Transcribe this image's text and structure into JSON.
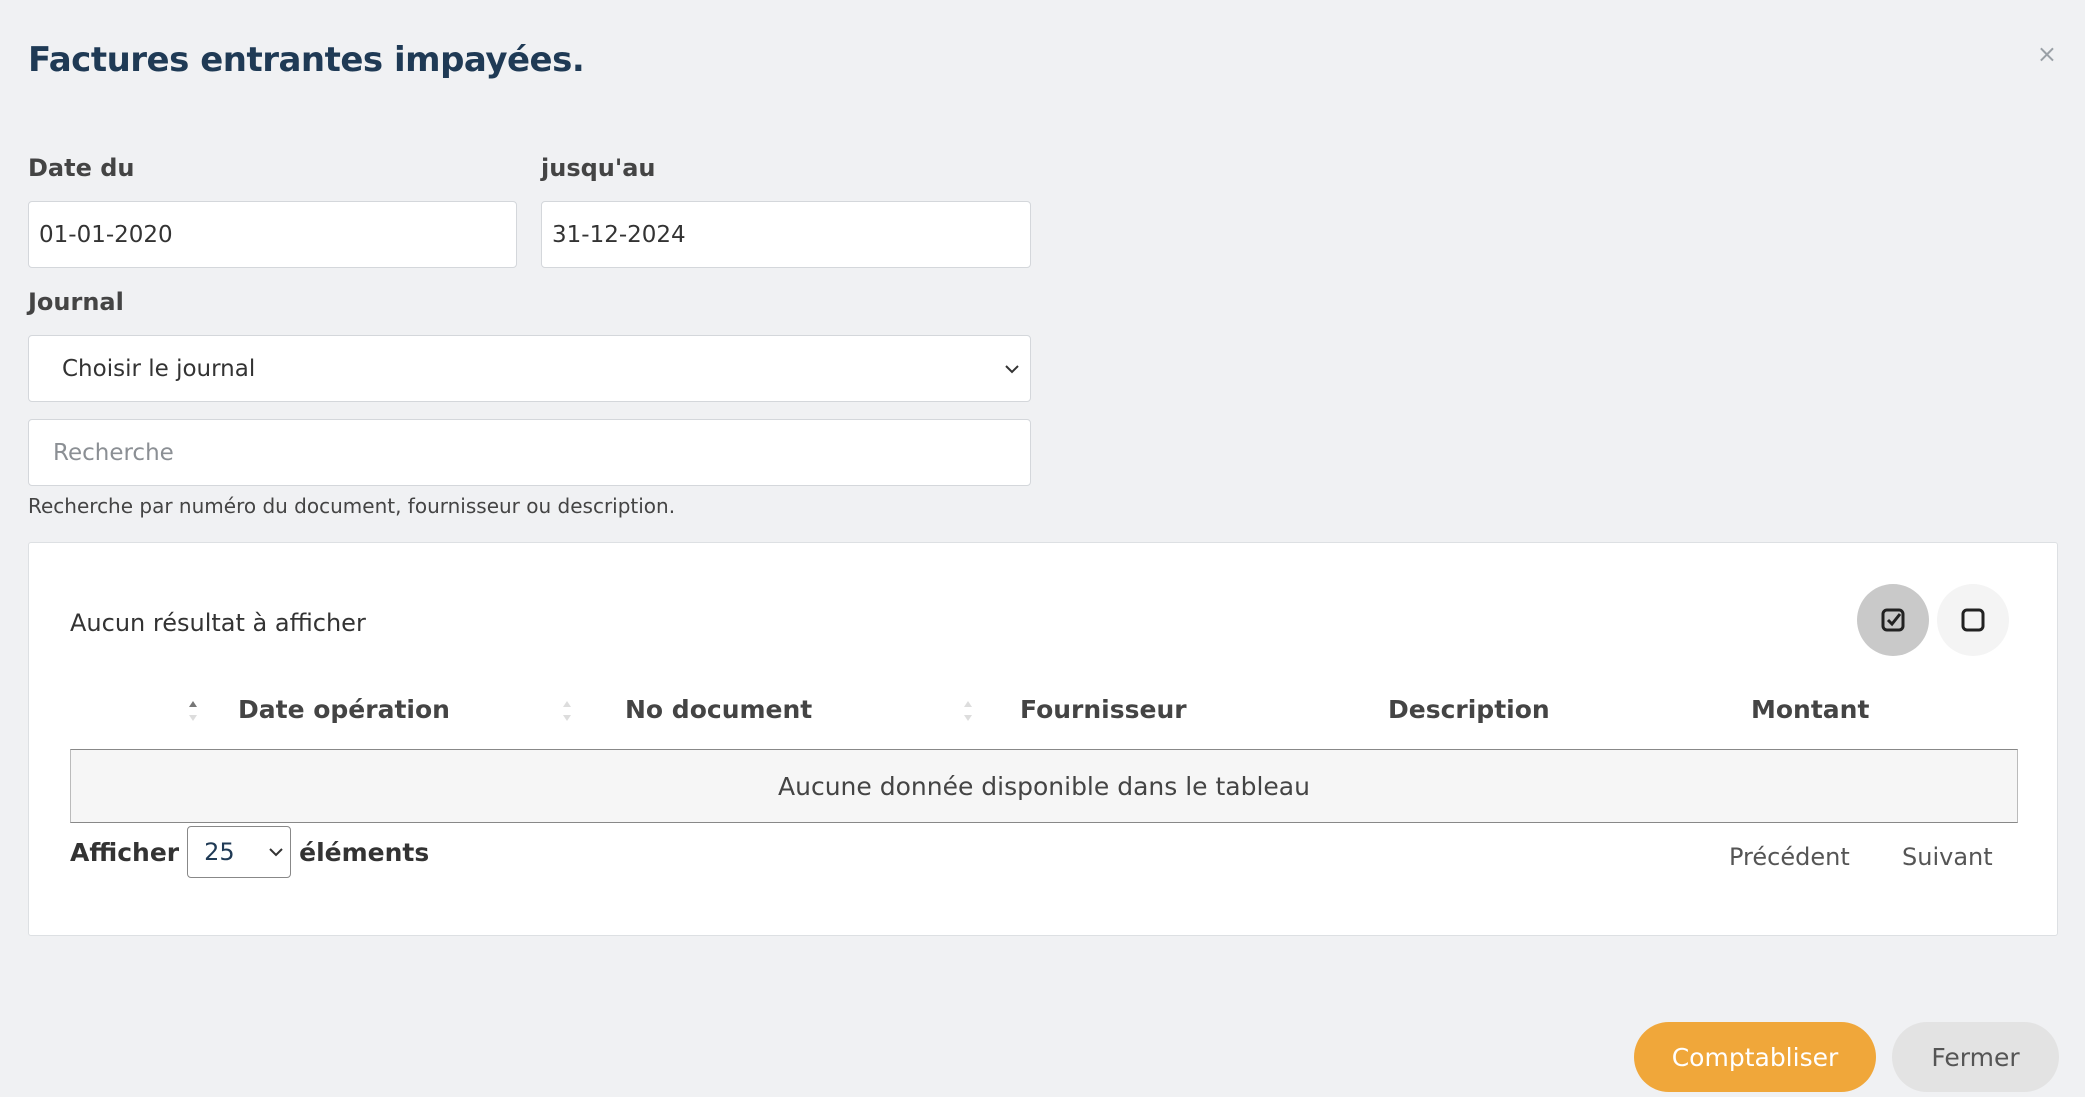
{
  "modal": {
    "title": "Factures entrantes impayées.",
    "close_glyph": "×"
  },
  "filters": {
    "date_from_label": "Date du",
    "date_from_value": "01-01-2020",
    "date_to_label": "jusqu'au",
    "date_to_value": "31-12-2024",
    "journal_label": "Journal",
    "journal_selected": "Choisir le journal",
    "search_placeholder": "Recherche",
    "search_help": "Recherche par numéro du document, fournisseur ou description."
  },
  "results": {
    "status_text": "Aucun résultat à afficher",
    "check_all_icon": "check-square-icon",
    "uncheck_all_icon": "square-icon",
    "columns": [
      "",
      "Date opération",
      "No document",
      "Fournisseur",
      "Description",
      "Montant"
    ],
    "empty_message": "Aucune donnée disponible dans le tableau",
    "show_label": "Afficher",
    "page_length": "25",
    "elements_label": "éléments",
    "prev_label": "Précédent",
    "next_label": "Suivant"
  },
  "footer": {
    "post_label": "Comptabliser",
    "close_label": "Fermer"
  },
  "colors": {
    "accent": "#f0a73a",
    "title": "#1f3a55",
    "background": "#f0f1f3"
  }
}
